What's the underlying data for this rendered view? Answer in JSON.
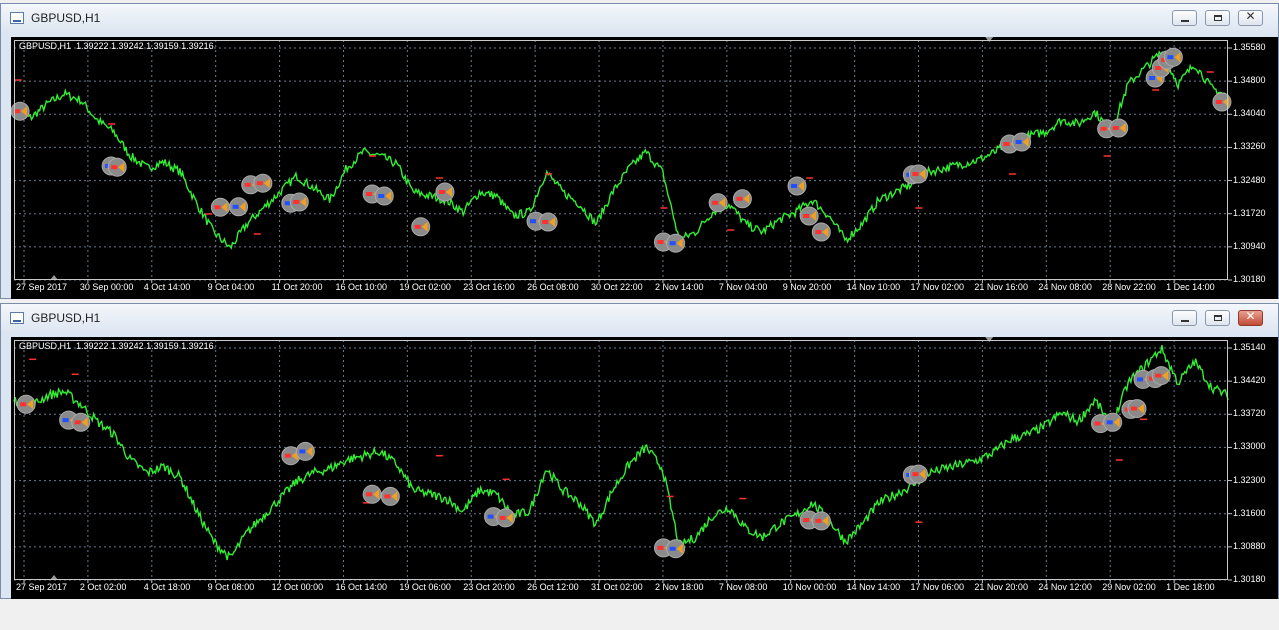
{
  "windows": [
    {
      "title": "GBPUSD,H1",
      "close_active": false,
      "header": "GBPUSD,H1  1.39222 1.39242 1.39159 1.39216",
      "price_labels": [
        "1.35580",
        "1.34800",
        "1.34040",
        "1.33260",
        "1.32480",
        "1.31720",
        "1.30940",
        "1.30180"
      ],
      "time_labels": [
        "27 Sep 2017",
        "30 Sep 00:00",
        "4 Oct 14:00",
        "9 Oct 04:00",
        "11 Oct 20:00",
        "16 Oct 10:00",
        "19 Oct 02:00",
        "23 Oct 16:00",
        "26 Oct 08:00",
        "30 Oct 22:00",
        "2 Nov 14:00",
        "7 Nov 04:00",
        "9 Nov 20:00",
        "14 Nov 10:00",
        "17 Nov 02:00",
        "21 Nov 16:00",
        "24 Nov 08:00",
        "28 Nov 22:00",
        "1 Dec 14:00"
      ],
      "ylim": [
        1.298,
        1.358
      ],
      "series_shape": [
        1.34,
        1.3385,
        1.342,
        1.3445,
        1.343,
        1.338,
        1.335,
        1.329,
        1.326,
        1.3275,
        1.325,
        1.317,
        1.31,
        1.306,
        1.312,
        1.316,
        1.32,
        1.324,
        1.321,
        1.318,
        1.326,
        1.33,
        1.329,
        1.327,
        1.32,
        1.319,
        1.318,
        1.315,
        1.32,
        1.319,
        1.314,
        1.315,
        1.325,
        1.32,
        1.317,
        1.312,
        1.32,
        1.326,
        1.33,
        1.325,
        1.308,
        1.31,
        1.315,
        1.317,
        1.312,
        1.31,
        1.313,
        1.315,
        1.318,
        1.314,
        1.308,
        1.312,
        1.318,
        1.32,
        1.322,
        1.325,
        1.326,
        1.327,
        1.328,
        1.33,
        1.333,
        1.334,
        1.335,
        1.338,
        1.337,
        1.34,
        1.335,
        1.347,
        1.351,
        1.355,
        1.347,
        1.352,
        1.346,
        1.344
      ],
      "trade_markers": [
        [
          0.005,
          1.3402
        ],
        [
          0.08,
          1.3265
        ],
        [
          0.085,
          1.3262
        ],
        [
          0.17,
          1.3162
        ],
        [
          0.185,
          1.3163
        ],
        [
          0.195,
          1.3218
        ],
        [
          0.205,
          1.3222
        ],
        [
          0.228,
          1.3172
        ],
        [
          0.235,
          1.3175
        ],
        [
          0.295,
          1.3195
        ],
        [
          0.305,
          1.319
        ],
        [
          0.335,
          1.3113
        ],
        [
          0.355,
          1.32
        ],
        [
          0.43,
          1.3127
        ],
        [
          0.44,
          1.3125
        ],
        [
          0.535,
          1.3075
        ],
        [
          0.545,
          1.3072
        ],
        [
          0.58,
          1.3173
        ],
        [
          0.6,
          1.3183
        ],
        [
          0.645,
          1.3215
        ],
        [
          0.655,
          1.314
        ],
        [
          0.665,
          1.31
        ],
        [
          0.74,
          1.3243
        ],
        [
          0.745,
          1.3245
        ],
        [
          0.82,
          1.332
        ],
        [
          0.83,
          1.3325
        ],
        [
          0.9,
          1.3358
        ],
        [
          0.91,
          1.336
        ],
        [
          0.94,
          1.3485
        ],
        [
          0.945,
          1.351
        ],
        [
          0.95,
          1.353
        ],
        [
          0.955,
          1.3537
        ],
        [
          0.995,
          1.3425
        ]
      ],
      "red_dashes": [
        [
          0.003,
          1.348
        ],
        [
          0.08,
          1.337
        ],
        [
          0.16,
          1.3145
        ],
        [
          0.2,
          1.3095
        ],
        [
          0.295,
          1.329
        ],
        [
          0.35,
          1.3235
        ],
        [
          0.44,
          1.3245
        ],
        [
          0.535,
          1.316
        ],
        [
          0.59,
          1.3105
        ],
        [
          0.655,
          1.3235
        ],
        [
          0.745,
          1.316
        ],
        [
          0.822,
          1.3245
        ],
        [
          0.9,
          1.329
        ],
        [
          0.94,
          1.3455
        ],
        [
          0.985,
          1.35
        ]
      ]
    },
    {
      "title": "GBPUSD,H1",
      "close_active": true,
      "header": "GBPUSD,H1  1.39222 1.39242 1.39159 1.39216",
      "price_labels": [
        "1.35140",
        "1.34420",
        "1.33720",
        "1.33000",
        "1.32300",
        "1.31600",
        "1.30880",
        "1.30180"
      ],
      "time_labels": [
        "27 Sep 2017",
        "2 Oct 02:00",
        "4 Oct 18:00",
        "9 Oct 08:00",
        "12 Oct 00:00",
        "16 Oct 14:00",
        "19 Oct 06:00",
        "23 Oct 20:00",
        "26 Oct 12:00",
        "31 Oct 02:00",
        "2 Nov 18:00",
        "7 Nov 08:00",
        "10 Nov 00:00",
        "14 Nov 14:00",
        "17 Nov 06:00",
        "21 Nov 20:00",
        "24 Nov 12:00",
        "29 Nov 02:00",
        "1 Dec 18:00"
      ],
      "ylim": [
        1.3,
        1.356
      ],
      "series_shape": [
        1.342,
        1.3405,
        1.343,
        1.344,
        1.341,
        1.337,
        1.334,
        1.328,
        1.325,
        1.3265,
        1.324,
        1.316,
        1.309,
        1.305,
        1.311,
        1.315,
        1.319,
        1.323,
        1.325,
        1.326,
        1.328,
        1.329,
        1.33,
        1.327,
        1.321,
        1.32,
        1.319,
        1.316,
        1.321,
        1.32,
        1.315,
        1.316,
        1.326,
        1.321,
        1.318,
        1.313,
        1.321,
        1.327,
        1.331,
        1.326,
        1.308,
        1.31,
        1.315,
        1.317,
        1.312,
        1.31,
        1.313,
        1.315,
        1.318,
        1.314,
        1.309,
        1.313,
        1.318,
        1.32,
        1.322,
        1.325,
        1.326,
        1.327,
        1.328,
        1.33,
        1.333,
        1.334,
        1.336,
        1.339,
        1.337,
        1.342,
        1.336,
        1.346,
        1.35,
        1.354,
        1.346,
        1.351,
        1.345,
        1.343
      ],
      "trade_markers": [
        [
          0.01,
          1.341
        ],
        [
          0.045,
          1.3373
        ],
        [
          0.055,
          1.3368
        ],
        [
          0.228,
          1.329
        ],
        [
          0.24,
          1.33
        ],
        [
          0.295,
          1.32
        ],
        [
          0.31,
          1.3195
        ],
        [
          0.395,
          1.3148
        ],
        [
          0.405,
          1.3145
        ],
        [
          0.535,
          1.3075
        ],
        [
          0.545,
          1.3073
        ],
        [
          0.655,
          1.314
        ],
        [
          0.665,
          1.3138
        ],
        [
          0.74,
          1.3245
        ],
        [
          0.745,
          1.3247
        ],
        [
          0.895,
          1.3365
        ],
        [
          0.905,
          1.3368
        ],
        [
          0.92,
          1.3398
        ],
        [
          0.925,
          1.34
        ],
        [
          0.93,
          1.3468
        ],
        [
          0.94,
          1.347
        ],
        [
          0.945,
          1.3477
        ]
      ],
      "red_dashes": [
        [
          0.015,
          1.3515
        ],
        [
          0.05,
          1.348
        ],
        [
          0.29,
          1.318
        ],
        [
          0.35,
          1.329
        ],
        [
          0.405,
          1.3235
        ],
        [
          0.54,
          1.3195
        ],
        [
          0.6,
          1.319
        ],
        [
          0.745,
          1.3135
        ],
        [
          0.91,
          1.328
        ],
        [
          0.93,
          1.3375
        ]
      ]
    }
  ],
  "colors": {
    "chart_bg": "#000000",
    "line": "#33ee33",
    "grid": "#6a7a8a",
    "marker_bg": "#8a8a8a",
    "marker_sell": "#ff3030",
    "marker_buy": "#2050ff",
    "marker_close": "#f0a020"
  }
}
